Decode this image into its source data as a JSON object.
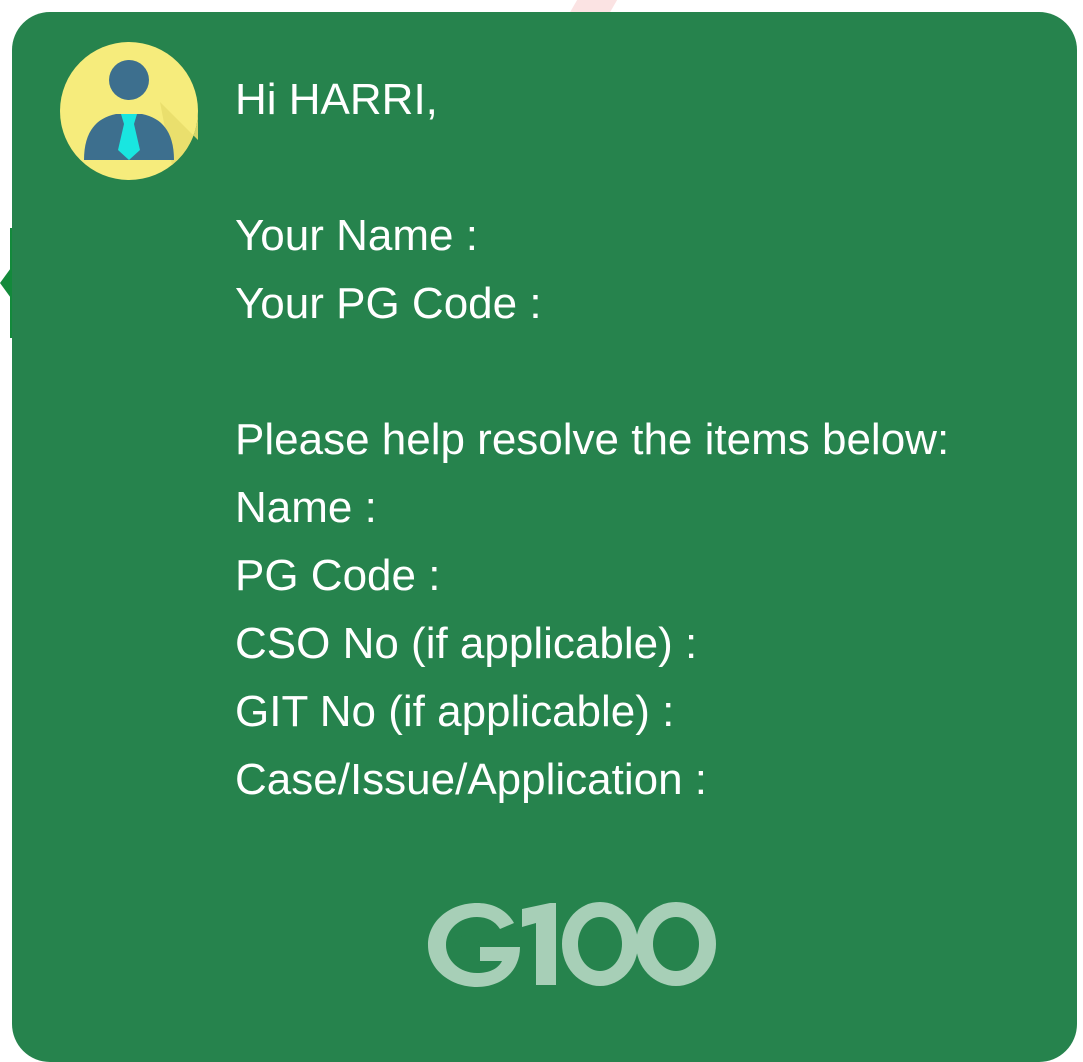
{
  "greeting": "Hi HARRI,",
  "fields_intro": [
    "Your Name :",
    "Your PG Code :"
  ],
  "request_heading": "Please help resolve the items below:",
  "request_items": [
    "Name :",
    "PG Code :",
    "CSO No (if applicable) :",
    "GIT No (if applicable) :",
    "Case/Issue/Application :"
  ],
  "logo_text": "G100",
  "colors": {
    "card_background": "#26834d",
    "avatar_circle": "#f6ec7c",
    "avatar_figure": "#3d6f8e",
    "tie": "#19e6e0",
    "logo": "#a7cfb7",
    "text": "#ffffff"
  },
  "icons": {
    "avatar": "user-avatar-icon",
    "logo": "g100-logo"
  }
}
